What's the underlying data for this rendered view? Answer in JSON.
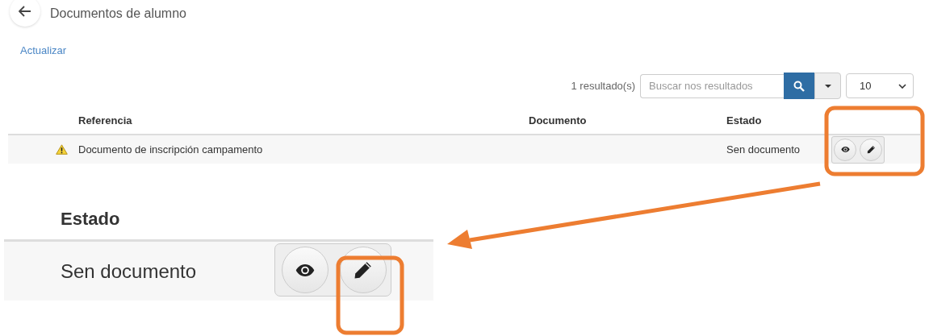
{
  "header": {
    "title": "Documentos de alumno"
  },
  "refresh_link": "Actualizar",
  "toolbar": {
    "result_count": "1 resultado(s)",
    "search": {
      "placeholder": "Buscar nos resultados"
    },
    "page_size": "10"
  },
  "table": {
    "columns": [
      "Referencia",
      "Documento",
      "Estado"
    ],
    "rows": [
      {
        "warning": true,
        "reference": "Documento de inscripción campamento",
        "status": "Sen documento"
      }
    ]
  },
  "zoom_inset": {
    "column": "Estado",
    "status": "Sen documento"
  }
}
